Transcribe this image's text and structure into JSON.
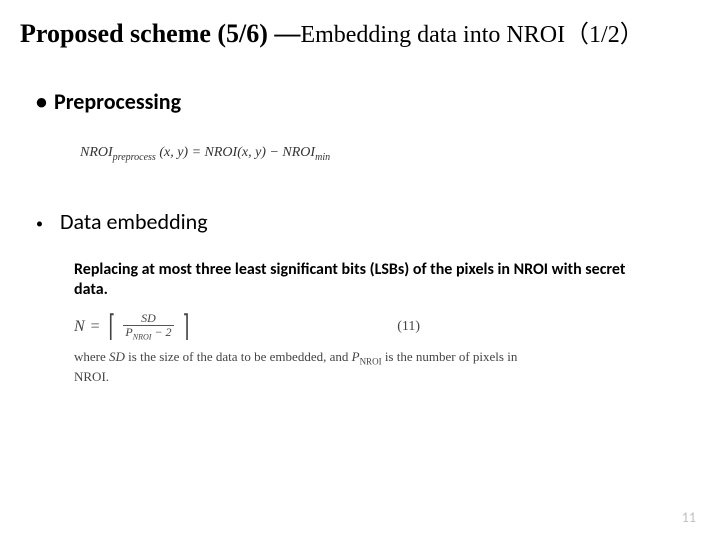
{
  "title": {
    "main": "Proposed scheme (5/6) —",
    "sub": "Embedding data into NROI（1/2）"
  },
  "bullets": {
    "preprocessing": "Preprocessing",
    "data_embedding": "Data embedding"
  },
  "formula1": {
    "lhs_base": "NROI",
    "lhs_sub": "preprocess",
    "lhs_args": "(x, y)",
    "eq": "=",
    "r1_base": "NROI",
    "r1_args": "(x, y)",
    "minus": "−",
    "r2_base": "NROI",
    "r2_sub": "min"
  },
  "desc": "Replacing at most three least significant bits (LSBs) of the pixels in NROI with secret data.",
  "formula2": {
    "N": "N",
    "eq": "=",
    "num": "SD",
    "den_base": "P",
    "den_sub": "NROI",
    "den_tail": " − 2",
    "tag": "(11)",
    "where1a": "where ",
    "where1b": "SD",
    "where1c": " is the size of the data to be embedded, and ",
    "where1d": "P",
    "where1e": "NROI",
    "where1f": " is the number of pixels in NROI."
  },
  "page": "11"
}
